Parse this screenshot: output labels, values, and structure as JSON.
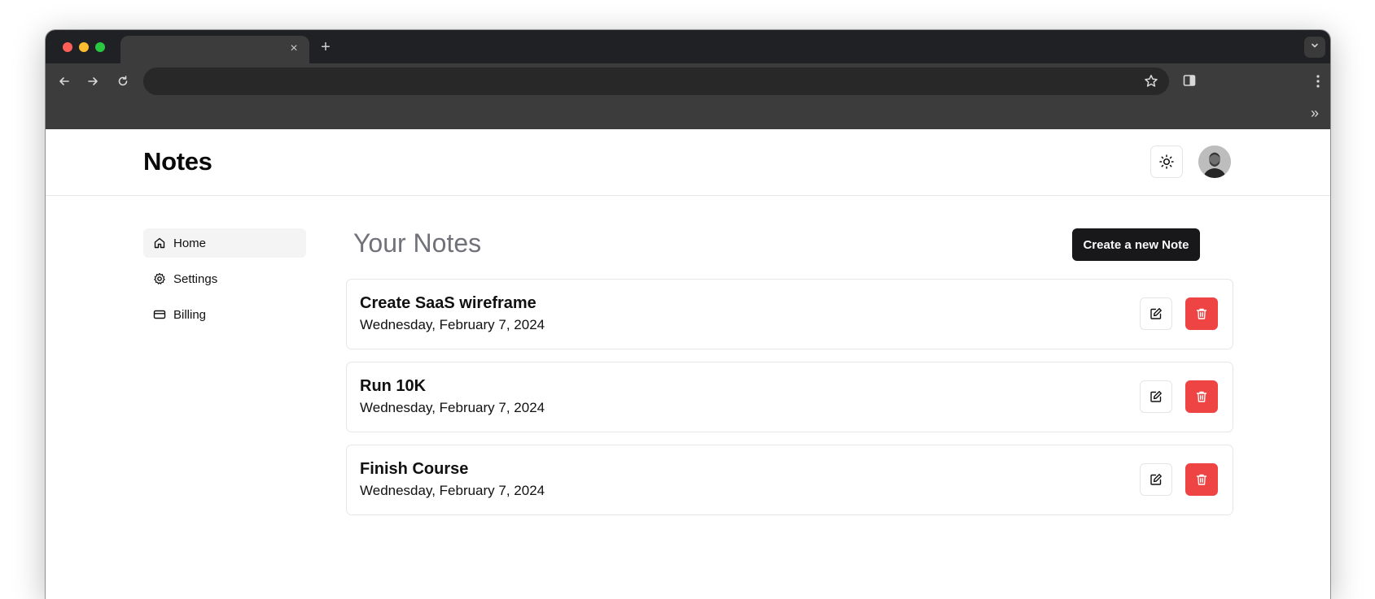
{
  "browser": {
    "tab_close": "×",
    "new_tab": "+",
    "bookmarks_overflow": "»"
  },
  "app": {
    "brand": "Notes"
  },
  "sidebar": {
    "items": [
      {
        "label": "Home",
        "icon": "home-icon",
        "active": true
      },
      {
        "label": "Settings",
        "icon": "gear-icon",
        "active": false
      },
      {
        "label": "Billing",
        "icon": "credit-card-icon",
        "active": false
      }
    ]
  },
  "main": {
    "title": "Your Notes",
    "create_label": "Create a new Note",
    "notes": [
      {
        "title": "Create SaaS wireframe",
        "date": "Wednesday, February 7, 2024"
      },
      {
        "title": "Run 10K",
        "date": "Wednesday, February 7, 2024"
      },
      {
        "title": "Finish Course",
        "date": "Wednesday, February 7, 2024"
      }
    ]
  },
  "colors": {
    "accent_dark": "#18181b",
    "delete_red": "#ef4444",
    "muted_text": "#71717a"
  }
}
